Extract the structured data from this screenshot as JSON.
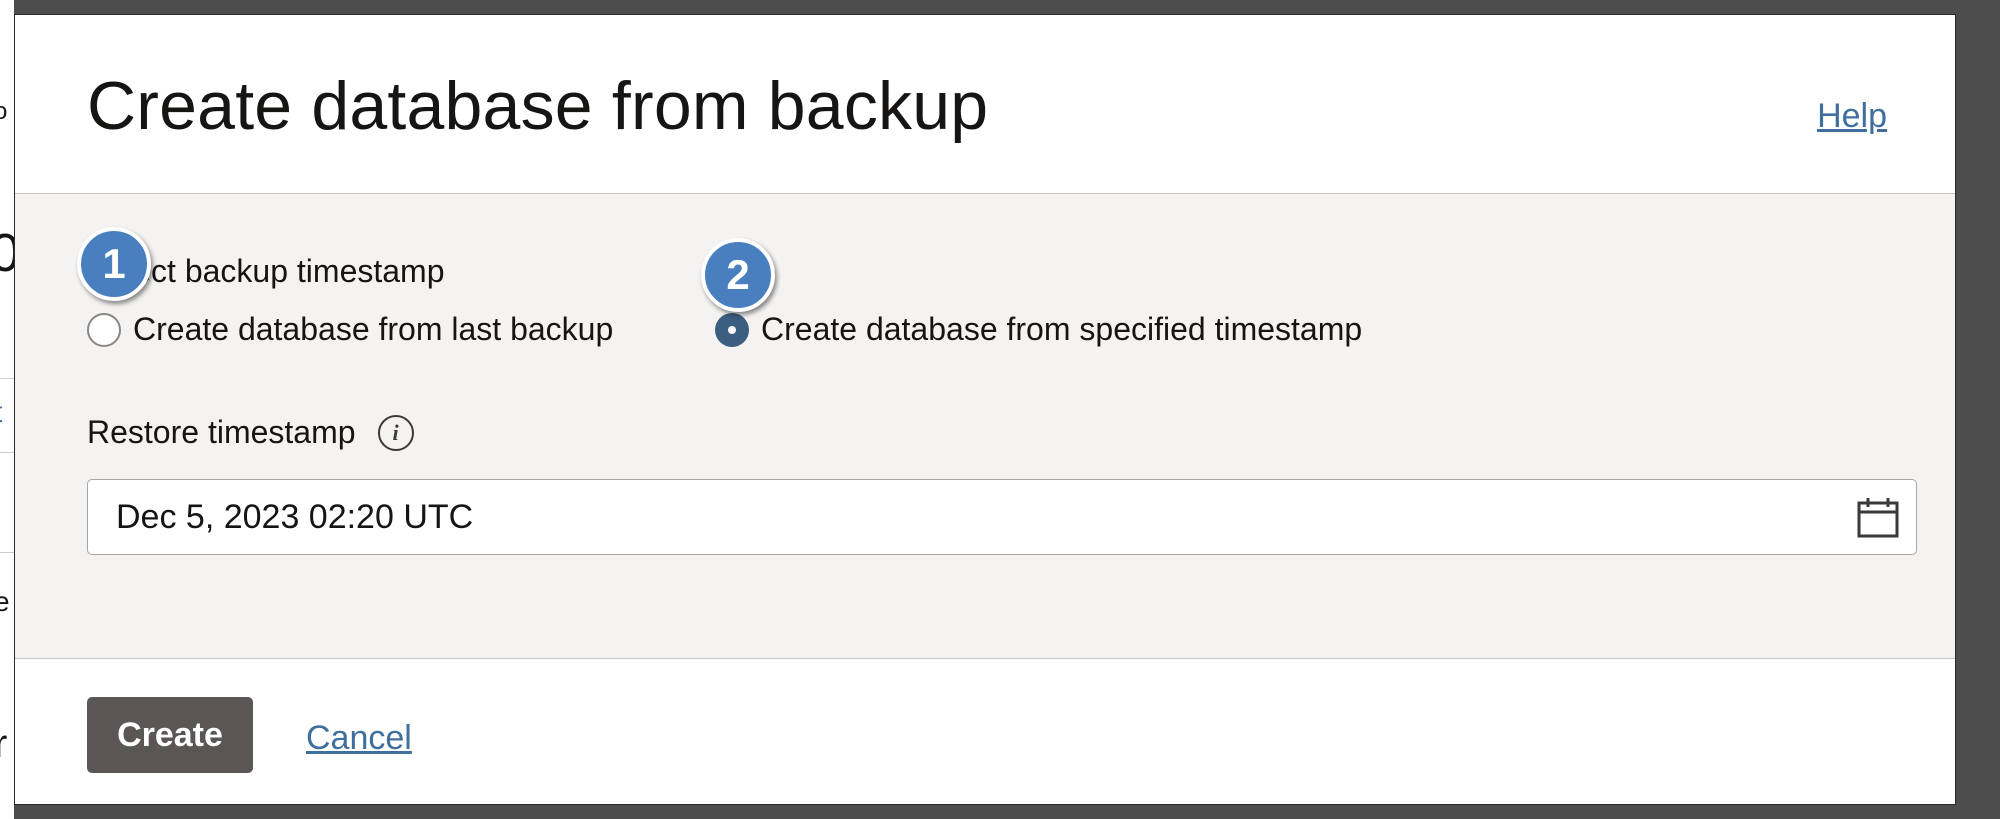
{
  "dialog": {
    "title": "Create database from backup",
    "help_label": "Help"
  },
  "background": {
    "fragments": [
      "o",
      "0",
      "t",
      "e",
      "r"
    ]
  },
  "backup_timestamp": {
    "group_label": "Select backup timestamp",
    "options": [
      {
        "label": "Create database from last backup",
        "selected": false
      },
      {
        "label": "Create database from specified timestamp",
        "selected": true
      }
    ]
  },
  "restore_timestamp": {
    "label": "Restore timestamp",
    "info_icon": "info-icon",
    "value": "Dec 5, 2023 02:20 UTC",
    "calendar_icon": "calendar-icon"
  },
  "footer": {
    "create_label": "Create",
    "cancel_label": "Cancel"
  },
  "callouts": [
    "1",
    "2"
  ],
  "colors": {
    "accent": "#3c5e7f",
    "link": "#3f6f9d",
    "primary_button": "#5a5655",
    "callout": "#4a7fbf",
    "body_bg": "#f4f3f2"
  }
}
